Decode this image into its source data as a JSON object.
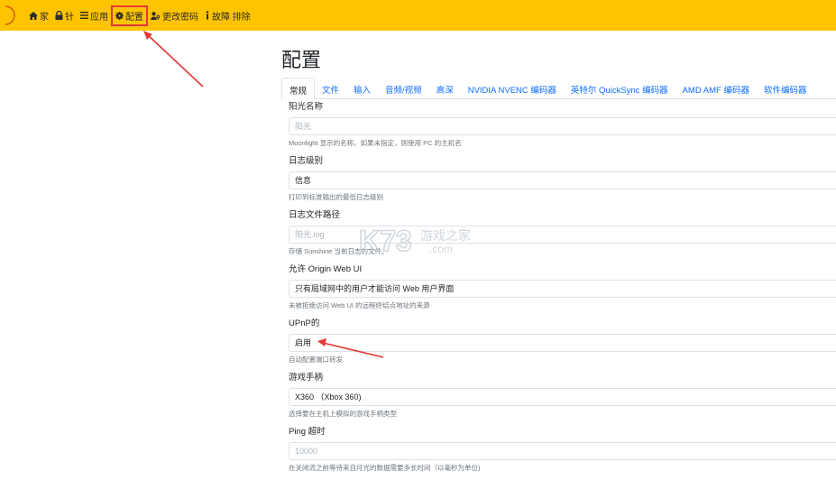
{
  "nav": {
    "items": [
      {
        "label": "家",
        "icon": "home-icon"
      },
      {
        "label": "针",
        "icon": "lock-icon"
      },
      {
        "label": "应用",
        "icon": "list-icon"
      },
      {
        "label": "配置",
        "icon": "gear-icon"
      },
      {
        "label": "更改密码",
        "icon": "user-key-icon"
      },
      {
        "label": "故障 排除",
        "icon": "info-icon"
      }
    ],
    "active_index": 3
  },
  "page": {
    "title": "配置"
  },
  "tabs": [
    "常规",
    "文件",
    "输入",
    "音频/视频",
    "高深",
    "NVIDIA NVENC 编码器",
    "英特尔 QuickSync 编码器",
    "AMD AMF 编码器",
    "软件编码器"
  ],
  "fields": [
    {
      "label": "阳光名称",
      "value": "阳光",
      "placeholder": true,
      "help": "Moonlight 显示的名称。如果未指定，则使用 PC 的主机名"
    },
    {
      "label": "日志级别",
      "value": "信息",
      "placeholder": false,
      "help": "打印到标准输出的最低日志级别"
    },
    {
      "label": "日志文件路径",
      "value": "阳光.log",
      "placeholder": true,
      "help": "存储 Sunshine 当前日志的文件。"
    },
    {
      "label": "允许 Origin Web UI",
      "value": "只有局域网中的用户才能访问 Web 用户界面",
      "placeholder": false,
      "help": "未被拒绝访问 Web UI 的远程终结点地址的来源"
    },
    {
      "label": "UPnP的",
      "value": "启用",
      "placeholder": false,
      "help": "自动配置端口转发"
    },
    {
      "label": "游戏手柄",
      "value": "X360 （Xbox 360)",
      "placeholder": false,
      "help": "选择要在主机上模拟的游戏手柄类型"
    },
    {
      "label": "Ping 超时",
      "value": "10000",
      "placeholder": true,
      "help": "在关闭流之前等待来自月光的数据需要多长时间（以毫秒为单位)"
    }
  ],
  "watermark": {
    "text_left": "K73",
    "text_right": "游戏之家",
    "text_sub": ".com"
  },
  "colors": {
    "navbar": "#ffc400",
    "accent_link": "#0d6efd",
    "annotation": "#e53935"
  }
}
